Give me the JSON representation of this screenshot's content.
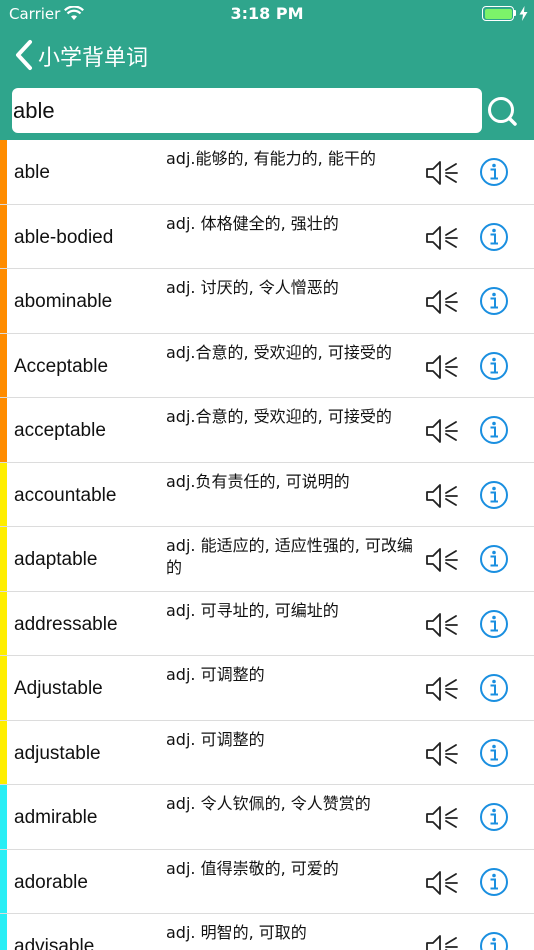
{
  "status_bar": {
    "carrier": "Carrier",
    "time": "3:18 PM",
    "battery_level": 1.0
  },
  "nav": {
    "title": "小学背单词",
    "back_icon": "chevron-left-icon"
  },
  "search": {
    "value": "able",
    "icon": "search-icon"
  },
  "colors": {
    "header": "#2fa58c",
    "info": "#1a8fe0",
    "stripe_orange": "#ff8c00",
    "stripe_yellow": "#ffee00",
    "stripe_cyan": "#29eef5"
  },
  "words": [
    {
      "word": "able",
      "meaning": "adj.能够的, 有能力的, 能干的",
      "stripe": "#ff8c00"
    },
    {
      "word": "able-bodied",
      "meaning": "adj. 体格健全的, 强壮的",
      "stripe": "#ff8c00"
    },
    {
      "word": "abominable",
      "meaning": "adj. 讨厌的, 令人憎恶的",
      "stripe": "#ff8c00"
    },
    {
      "word": "Acceptable",
      "meaning": "adj.合意的, 受欢迎的, 可接受的",
      "stripe": "#ff8c00"
    },
    {
      "word": "acceptable",
      "meaning": "adj.合意的, 受欢迎的, 可接受的",
      "stripe": "#ff8c00"
    },
    {
      "word": "accountable",
      "meaning": "adj.负有责任的, 可说明的",
      "stripe": "#ffee00"
    },
    {
      "word": "adaptable",
      "meaning": "adj. 能适应的, 适应性强的, 可改编的",
      "stripe": "#ffee00"
    },
    {
      "word": "addressable",
      "meaning": "adj. 可寻址的, 可编址的",
      "stripe": "#ffee00"
    },
    {
      "word": "Adjustable",
      "meaning": "adj. 可调整的",
      "stripe": "#ffee00"
    },
    {
      "word": "adjustable",
      "meaning": "adj. 可调整的",
      "stripe": "#ffee00"
    },
    {
      "word": "admirable",
      "meaning": "adj. 令人钦佩的, 令人赞赏的",
      "stripe": "#29eef5"
    },
    {
      "word": "adorable",
      "meaning": "adj. 值得崇敬的, 可爱的",
      "stripe": "#29eef5"
    },
    {
      "word": "advisable",
      "meaning": "adj. 明智的, 可取的",
      "stripe": "#29eef5"
    }
  ]
}
